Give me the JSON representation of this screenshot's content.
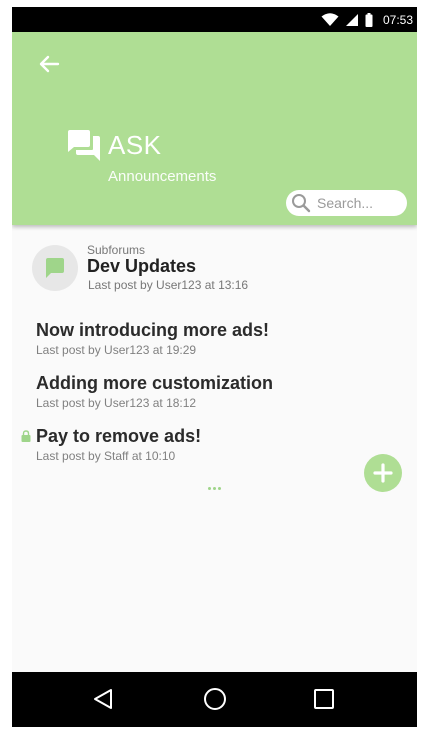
{
  "status_bar": {
    "time": "07:53"
  },
  "header": {
    "title": "ASK",
    "subtitle": "Announcements",
    "search_placeholder": "Search..."
  },
  "subforum": {
    "section_label": "Subforums",
    "name": "Dev Updates",
    "last_post": "Last post by User123 at 13:16"
  },
  "threads": [
    {
      "title": "Now introducing more ads!",
      "last_post": "Last post by User123 at 19:29",
      "locked": false
    },
    {
      "title": "Adding more customization",
      "last_post": "Last post by User123 at 18:12",
      "locked": false
    },
    {
      "title": "Pay to remove ads!",
      "last_post": "Last post by Staff at 10:10",
      "locked": true
    }
  ],
  "icons": {
    "back": "arrow-back-icon",
    "forum": "forum-chat-icon",
    "search": "search-icon",
    "subforum": "chat-bubble-icon",
    "lock": "lock-icon",
    "fab": "plus-icon",
    "more": "more-horizontal-icon",
    "nav_back": "triangle-back-icon",
    "nav_home": "circle-home-icon",
    "nav_recents": "square-recents-icon"
  },
  "colors": {
    "accent": "#afde94",
    "status_bar": "#000000",
    "nav_bar": "#000000",
    "background": "#fafafa"
  }
}
